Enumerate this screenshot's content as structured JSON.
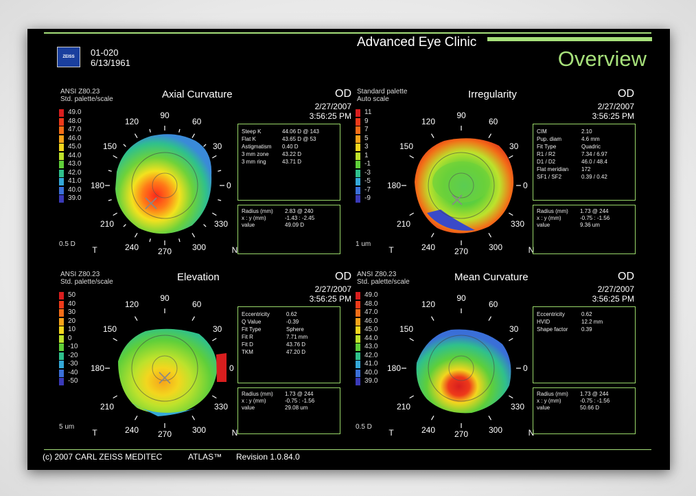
{
  "header": {
    "logo_text": "ZEISS",
    "patient_id": "01-020",
    "patient_dob": "6/13/1961",
    "clinic": "Advanced Eye Clinic",
    "view_title": "Overview"
  },
  "angles": {
    "a90": "90",
    "a120": "120",
    "a60": "60",
    "a150": "150",
    "a30": "30",
    "a180": "180",
    "a0": "0",
    "a210": "210",
    "a330": "330",
    "a240": "240",
    "a300": "300",
    "a270": "270",
    "t": "T",
    "n": "N"
  },
  "panels": {
    "axial": {
      "title": "Axial Curvature",
      "palette1": "ANSI Z80.23",
      "palette2": "Std. palette/scale",
      "eye": "OD",
      "date": "2/27/2007",
      "time": "3:56:25 PM",
      "unit": "0.5 D",
      "scale": [
        "49.0",
        "48.0",
        "47.0",
        "46.0",
        "45.0",
        "44.0",
        "43.0",
        "42.0",
        "41.0",
        "40.0",
        "39.0"
      ],
      "info_labels": [
        "Steep K",
        "Flat K",
        "Astigmatism",
        "3 mm zone",
        "3 mm ring"
      ],
      "info_values": [
        "44.06 D @ 143",
        "43.65 D @ 53",
        "0.40 D",
        "43.22 D",
        "43.71 D"
      ],
      "cursor_labels": [
        "Radius  (mm)",
        "x : y  (mm)",
        "value"
      ],
      "cursor_values": [
        "2.83  @ 240",
        "-1.43 : -2.45",
        "49.09 D"
      ]
    },
    "irregularity": {
      "title": "Irregularity",
      "palette1": "Standard palette",
      "palette2": "Auto scale",
      "eye": "OD",
      "date": "2/27/2007",
      "time": "3:56:25 PM",
      "unit": "1 um",
      "scale": [
        "11",
        "9",
        "7",
        "5",
        "3",
        "1",
        "-1",
        "-3",
        "-5",
        "-7",
        "-9"
      ],
      "info_labels": [
        "CIM",
        "Pup. diam",
        "Fit Type",
        "R1 / R2",
        "D1 / D2",
        "Flat meridian",
        "SF1 / SF2"
      ],
      "info_values": [
        "2.10",
        "4.6 mm",
        "Quadric",
        "7.34 / 6.97",
        "46.0 / 48.4",
        "172",
        "0.39 / 0.42"
      ],
      "cursor_labels": [
        "Radius  (mm)",
        "x : y  (mm)",
        "value"
      ],
      "cursor_values": [
        "1.73  @ 244",
        "-0.75 : -1.56",
        "9.36 um"
      ]
    },
    "elevation": {
      "title": "Elevation",
      "palette1": "ANSI Z80.23",
      "palette2": "Std. palette/scale",
      "eye": "OD",
      "date": "2/27/2007",
      "time": "3:56:25 PM",
      "unit": "5 um",
      "scale": [
        "50",
        "40",
        "30",
        "20",
        "10",
        "0",
        "-10",
        "-20",
        "-30",
        "-40",
        "-50"
      ],
      "info_labels": [
        "Eccentricity",
        "Q Value",
        "Fit Type",
        "Fit R",
        "Fit D",
        "TKM"
      ],
      "info_values": [
        "0.62",
        "-0.39",
        "Sphere",
        "7.71 mm",
        "43.76 D",
        "47.20 D"
      ],
      "cursor_labels": [
        "Radius  (mm)",
        "x : y  (mm)",
        "value"
      ],
      "cursor_values": [
        "1.73  @ 244",
        "-0.75 : -1.56",
        "29.08 um"
      ]
    },
    "mean": {
      "title": "Mean Curvature",
      "palette1": "ANSI Z80.23",
      "palette2": "Std. palette/scale",
      "eye": "OD",
      "date": "2/27/2007",
      "time": "3:56:25 PM",
      "unit": "0.5 D",
      "scale": [
        "49.0",
        "48.0",
        "47.0",
        "46.0",
        "45.0",
        "44.0",
        "43.0",
        "42.0",
        "41.0",
        "40.0",
        "39.0"
      ],
      "info_labels": [
        "Eccentricity",
        "HVID",
        "Shape factor"
      ],
      "info_values": [
        "0.62",
        "12.2 mm",
        "0.39"
      ],
      "cursor_labels": [
        "Radius  (mm)",
        "x : y  (mm)",
        "value"
      ],
      "cursor_values": [
        "1.73  @ 244",
        "-0.75 : -1.56",
        "50.66 D"
      ]
    }
  },
  "scale_colors": [
    "#d81e1e",
    "#ee3a1a",
    "#f36d17",
    "#f6a31a",
    "#f3d61e",
    "#bde22c",
    "#5fcf3a",
    "#2fc08c",
    "#34a8d8",
    "#3a6fd8",
    "#3a3ab8"
  ],
  "footer": {
    "copyright": "(c) 2007 CARL ZEISS MEDITEC",
    "product": "ATLAS™",
    "revision": "Revision  1.0.84.0"
  }
}
